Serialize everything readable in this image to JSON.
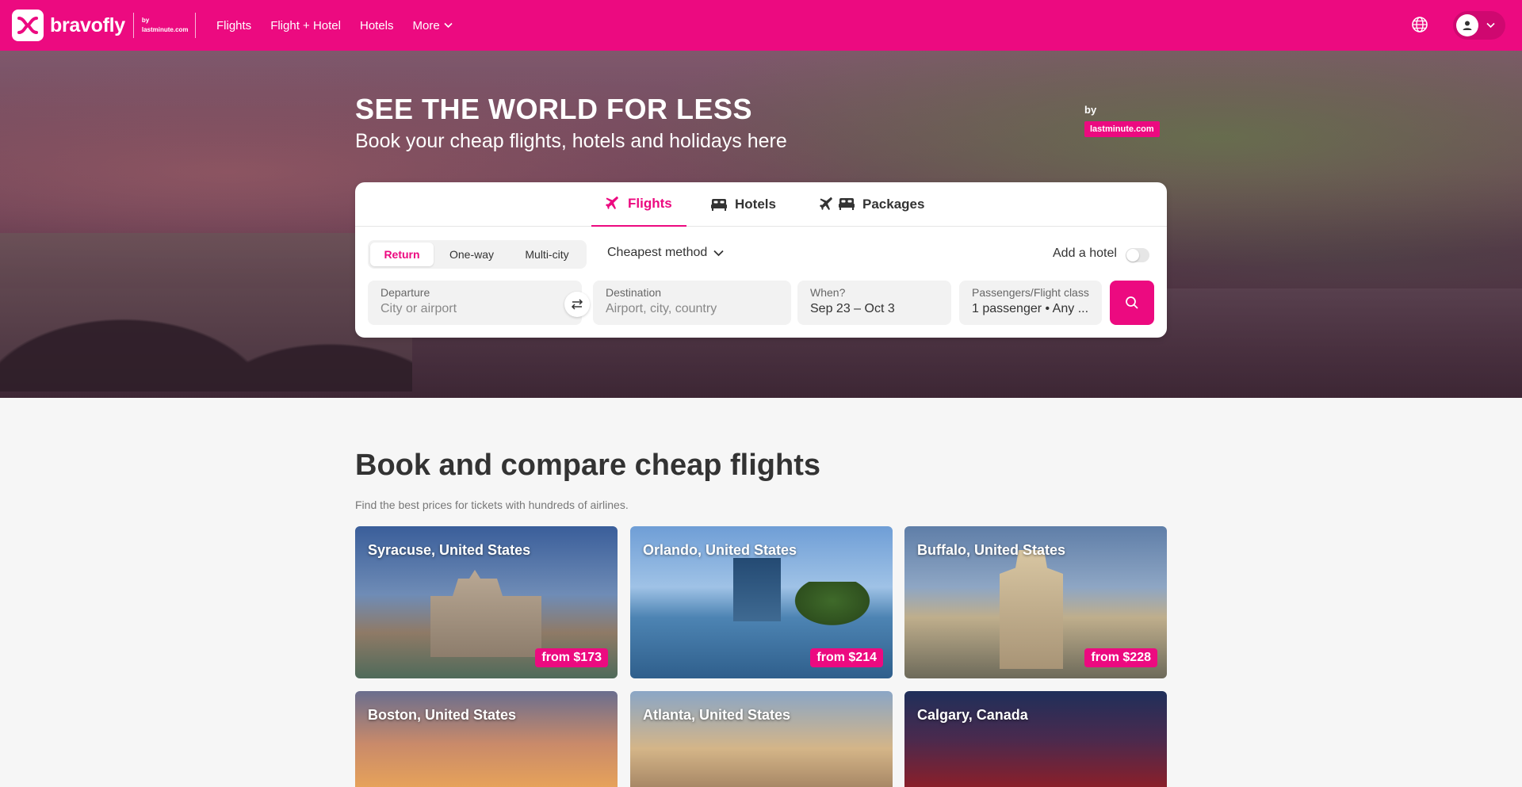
{
  "brand": {
    "name": "bravofly",
    "by_line_1": "by",
    "by_line_2": "lastminute.com"
  },
  "nav": {
    "items": [
      {
        "label": "Flights"
      },
      {
        "label": "Flight + Hotel"
      },
      {
        "label": "Hotels"
      },
      {
        "label": "More"
      }
    ],
    "icons": {
      "language": "globe-icon",
      "account": "user-icon"
    }
  },
  "hero": {
    "title": "SEE THE WORLD FOR LESS",
    "subtitle": "Book your cheap flights, hotels and holidays here",
    "by": "by",
    "badge": "lastminute.com"
  },
  "search": {
    "tabs": [
      {
        "label": "Flights",
        "icon": "plane-icon",
        "active": true
      },
      {
        "label": "Hotels",
        "icon": "bed-icon",
        "active": false
      },
      {
        "label": "Packages",
        "icon": "plane-bed-icon",
        "active": false
      }
    ],
    "trip_types": [
      {
        "label": "Return",
        "active": true
      },
      {
        "label": "One-way",
        "active": false
      },
      {
        "label": "Multi-city",
        "active": false
      }
    ],
    "sort_label": "Cheapest method",
    "add_hotel_label": "Add a hotel",
    "add_hotel_enabled": false,
    "departure": {
      "label": "Departure",
      "placeholder": "City or airport"
    },
    "destination": {
      "label": "Destination",
      "placeholder": "Airport, city, country"
    },
    "when": {
      "label": "When?",
      "value": "Sep 23 – Oct 3"
    },
    "passengers": {
      "label": "Passengers/Flight class",
      "value": "1 passenger • Any ..."
    }
  },
  "section": {
    "title": "Book and compare cheap flights",
    "subtitle": "Find the best prices for tickets with hundreds of airlines.",
    "destinations": [
      {
        "name": "Syracuse, United States",
        "price": "from $173"
      },
      {
        "name": "Orlando, United States",
        "price": "from $214"
      },
      {
        "name": "Buffalo, United States",
        "price": "from $228"
      },
      {
        "name": "Boston, United States",
        "price": ""
      },
      {
        "name": "Atlanta, United States",
        "price": ""
      },
      {
        "name": "Calgary, Canada",
        "price": ""
      }
    ]
  },
  "colors": {
    "brand": "#ec0a80"
  }
}
